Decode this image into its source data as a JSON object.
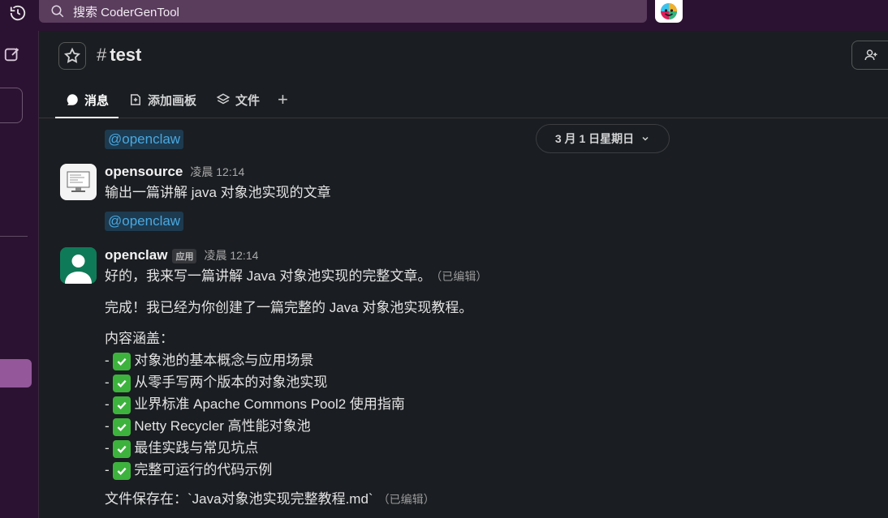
{
  "topbar": {
    "search_placeholder": "搜索 CoderGenTool"
  },
  "channel": {
    "hash": "#",
    "name": "test"
  },
  "tabs": [
    {
      "label": "消息"
    },
    {
      "label": "添加画板"
    },
    {
      "label": "文件"
    }
  ],
  "tab_add": "+",
  "date_divider": "3 月 1 日星期日",
  "top_mention": "@openclaw",
  "messages": {
    "m1": {
      "author": "opensource",
      "time": "凌晨 12:14",
      "text": "输出一篇讲解 java 对象池实现的文章",
      "mention": "@openclaw"
    },
    "m2": {
      "author": "openclaw",
      "badge": "应用",
      "time": "凌晨 12:14",
      "line1": "好的，我来写一篇讲解 Java 对象池实现的完整文章。",
      "edited1": "（已编辑）",
      "line2": "完成！我已经为你创建了一篇完整的 Java 对象池实现教程。",
      "coverage_title": "内容涵盖：",
      "items": [
        "对象池的基本概念与应用场景",
        "从零手写两个版本的对象池实现",
        "业界标准 Apache Commons Pool2 使用指南",
        "Netty Recycler 高性能对象池",
        "最佳实践与常见坑点",
        "完整可运行的代码示例"
      ],
      "item_prefix": "-",
      "footer": "文件保存在：`Java对象池实现完整教程.md`",
      "edited2": "（已编辑）"
    }
  },
  "colors": {
    "sidebar": "#2c1232",
    "search": "#5a3c5d",
    "active_rail": "#94589a",
    "mention_bg": "#1d3a4f",
    "mention_fg": "#4aa8e0",
    "check": "#3db33d",
    "avatar_green": "#0f7a57"
  }
}
